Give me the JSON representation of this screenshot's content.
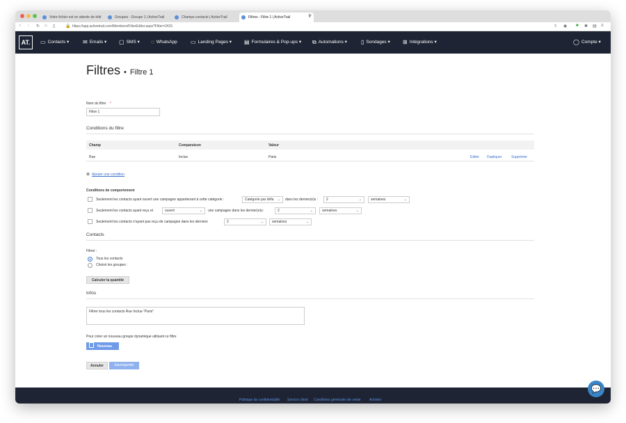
{
  "browser": {
    "tabs": [
      {
        "label": "Votre fichier est en attente de télé"
      },
      {
        "label": "Groupes - Groupe 1 | ActiveTrail"
      },
      {
        "label": "Champs contacts | ActiveTrail"
      },
      {
        "label": "Filtres - Filtre 1 | ActiveTrail"
      }
    ],
    "new_tab": "+",
    "url": "https://app.activetrail.com/Members/FilterEditor.aspx?Filter=2415"
  },
  "nav": {
    "logo": "AT.",
    "items": [
      {
        "label": "Contacts ▾"
      },
      {
        "label": "Emails ▾"
      },
      {
        "label": "SMS ▾"
      },
      {
        "label": "WhatsApp"
      },
      {
        "label": "Landing Pages ▾"
      },
      {
        "label": "Formulaires & Pop-ups ▾"
      },
      {
        "label": "Automations ▾"
      },
      {
        "label": "Sondages ▾"
      },
      {
        "label": "Intégrations ▾"
      }
    ],
    "account": "Compte ▾"
  },
  "page": {
    "title": "Filtres",
    "bullet": "•",
    "subtitle": "Filtre 1",
    "filter_name_label": "Nom du filtre",
    "required_mark": "*",
    "filter_name_value": "Filtre 1",
    "conditions_title": "Conditions du filtre",
    "table": {
      "headers": [
        "Champ",
        "Comparaison",
        "Valeur"
      ],
      "row": {
        "champ": "Rue",
        "comparaison": "Inclus",
        "valeur": "Paris"
      },
      "actions": [
        "Editer",
        "Dupliquer",
        "Supprimer"
      ]
    },
    "add_condition_icon": "⊕",
    "add_condition": "Ajouter une condition",
    "behavior_title": "Conditions de comportement",
    "behavior": [
      {
        "text": "Seulement les contacts ayant ouvert une campagne appartenant à cette catégorie :",
        "select1": "Catégorie par défa",
        "mid": "dans les dernier(e)s :",
        "select2": "2",
        "select3": "semaines"
      },
      {
        "text": "Seulement les contacts ayant reçu et",
        "select1": "ouvert",
        "mid": "une campagne dans les dernier(e)s:",
        "select2": "2",
        "select3": "semaines"
      },
      {
        "text": "Seulement les contacts n'ayant pas reçu de campagne dans les derniers",
        "select1": "2",
        "select2": "semaines"
      }
    ],
    "contacts_title": "Contacts",
    "filtrer_label": "Filtrer :",
    "radio_all": "Tous les contacts",
    "radio_groups": "Choisir les groupes :",
    "calc_button": "Calculer la quantité",
    "infos_title": "Infos",
    "infos_text": "Filtrer tous les contacts Rue Inclus-\"Paris\"",
    "dynamic_group_text": "Pour créer un nouveau groupe dynamique utilisant ce filtre",
    "new_button": "Nouveau",
    "cancel_button": "Annuler",
    "save_button": "Sauvegarder"
  },
  "footer": {
    "links": [
      "Politique de confidentialité",
      "Service client",
      "Conditions générales de vente",
      "Acheter"
    ]
  },
  "colors": {
    "nav_bg": "#1e2433",
    "link": "#3a6fc9",
    "primary_button": "#6f9be8"
  }
}
